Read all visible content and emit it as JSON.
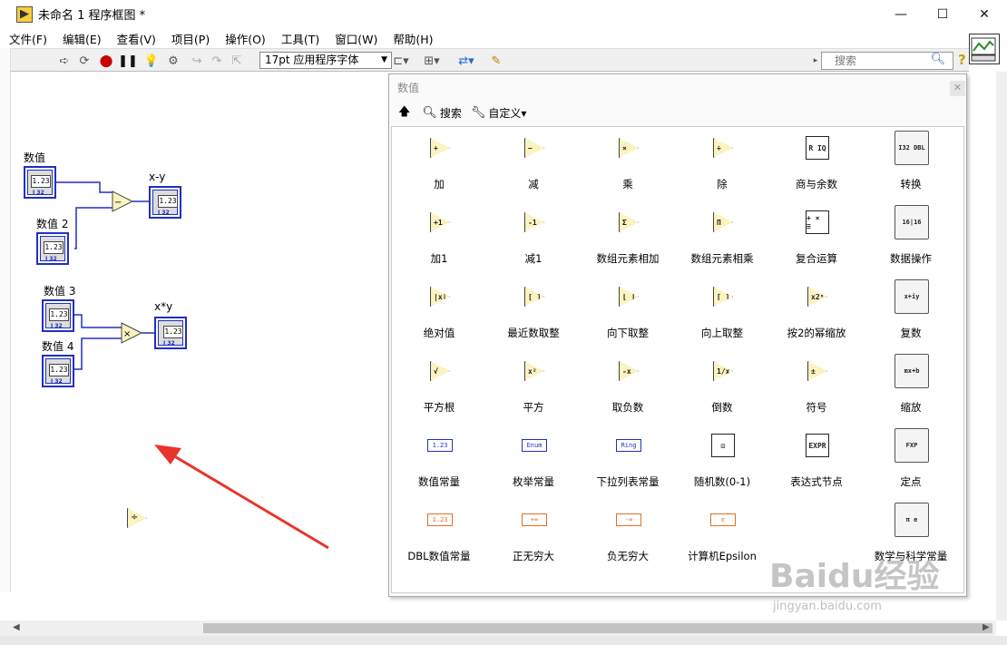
{
  "window": {
    "title": "未命名 1 程序框图 *",
    "minimize": "—",
    "maximize": "☐",
    "close": "✕"
  },
  "menu": [
    "文件(F)",
    "编辑(E)",
    "查看(V)",
    "项目(P)",
    "操作(O)",
    "工具(T)",
    "窗口(W)",
    "帮助(H)"
  ],
  "toolbar": {
    "font": "17pt 应用程序字体",
    "search_placeholder": "搜索",
    "help": "?"
  },
  "diagram": {
    "controls": [
      {
        "label": "数值",
        "value": "1.23",
        "dtype": "I 32"
      },
      {
        "label": "数值 2",
        "value": "1.23",
        "dtype": "I 32"
      },
      {
        "label": "数值 3",
        "value": "1.23",
        "dtype": "I 32"
      },
      {
        "label": "数值 4",
        "value": "1.23",
        "dtype": "I 32"
      }
    ],
    "indicators": [
      {
        "label": "x-y",
        "value": "1.23",
        "dtype": "I 32"
      },
      {
        "label": "x*y",
        "value": "1.23",
        "dtype": "I 32"
      }
    ],
    "ops": {
      "subtract": "−",
      "multiply": "×",
      "divide": "÷"
    }
  },
  "palette": {
    "title": "数值",
    "tools": {
      "search": "搜索",
      "customize": "自定义▾"
    },
    "items": [
      {
        "label": "加",
        "glyph": "+",
        "kind": "tri"
      },
      {
        "label": "减",
        "glyph": "−",
        "kind": "tri"
      },
      {
        "label": "乘",
        "glyph": "×",
        "kind": "tri"
      },
      {
        "label": "除",
        "glyph": "÷",
        "kind": "tri"
      },
      {
        "label": "商与余数",
        "glyph": "R IQ",
        "kind": "box"
      },
      {
        "label": "转换",
        "glyph": "I32 DBL",
        "kind": "folder"
      },
      {
        "label": "加1",
        "glyph": "+1",
        "kind": "tri"
      },
      {
        "label": "减1",
        "glyph": "-1",
        "kind": "tri"
      },
      {
        "label": "数组元素相加",
        "glyph": "Σ",
        "kind": "tri"
      },
      {
        "label": "数组元素相乘",
        "glyph": "Π",
        "kind": "tri"
      },
      {
        "label": "复合运算",
        "glyph": "+ × ≡",
        "kind": "box"
      },
      {
        "label": "数据操作",
        "glyph": "16|16",
        "kind": "folder"
      },
      {
        "label": "绝对值",
        "glyph": "|x|",
        "kind": "tri"
      },
      {
        "label": "最近数取整",
        "glyph": "[ ]",
        "kind": "tri"
      },
      {
        "label": "向下取整",
        "glyph": "⌊ ⌋",
        "kind": "tri"
      },
      {
        "label": "向上取整",
        "glyph": "⌈ ⌉",
        "kind": "tri"
      },
      {
        "label": "按2的幂缩放",
        "glyph": "x2ⁿ",
        "kind": "tri"
      },
      {
        "label": "复数",
        "glyph": "x+iy",
        "kind": "folder"
      },
      {
        "label": "平方根",
        "glyph": "√",
        "kind": "tri"
      },
      {
        "label": "平方",
        "glyph": "x²",
        "kind": "tri"
      },
      {
        "label": "取负数",
        "glyph": "-x",
        "kind": "tri"
      },
      {
        "label": "倒数",
        "glyph": "1/x",
        "kind": "tri"
      },
      {
        "label": "符号",
        "glyph": "±",
        "kind": "tri"
      },
      {
        "label": "缩放",
        "glyph": "mx+b",
        "kind": "folder"
      },
      {
        "label": "数值常量",
        "glyph": "1.23",
        "kind": "const"
      },
      {
        "label": "枚举常量",
        "glyph": "Enum",
        "kind": "const"
      },
      {
        "label": "下拉列表常量",
        "glyph": "Ring",
        "kind": "const"
      },
      {
        "label": "随机数(0-1)",
        "glyph": "⚄",
        "kind": "box"
      },
      {
        "label": "表达式节点",
        "glyph": "EXPR",
        "kind": "box"
      },
      {
        "label": "定点",
        "glyph": "FXP",
        "kind": "folder"
      },
      {
        "label": "DBL数值常量",
        "glyph": "1.23",
        "kind": "const-orange"
      },
      {
        "label": "正无穷大",
        "glyph": "+∞",
        "kind": "const-orange"
      },
      {
        "label": "负无穷大",
        "glyph": "-∞",
        "kind": "const-orange"
      },
      {
        "label": "计算机Epsilon",
        "glyph": "ε",
        "kind": "const-orange"
      },
      {
        "label": "",
        "glyph": "",
        "kind": "none"
      },
      {
        "label": "数学与科学常量",
        "glyph": "π e",
        "kind": "folder"
      }
    ]
  },
  "watermark": {
    "brand": "Baidu经验",
    "url": "jingyan.baidu.com"
  }
}
